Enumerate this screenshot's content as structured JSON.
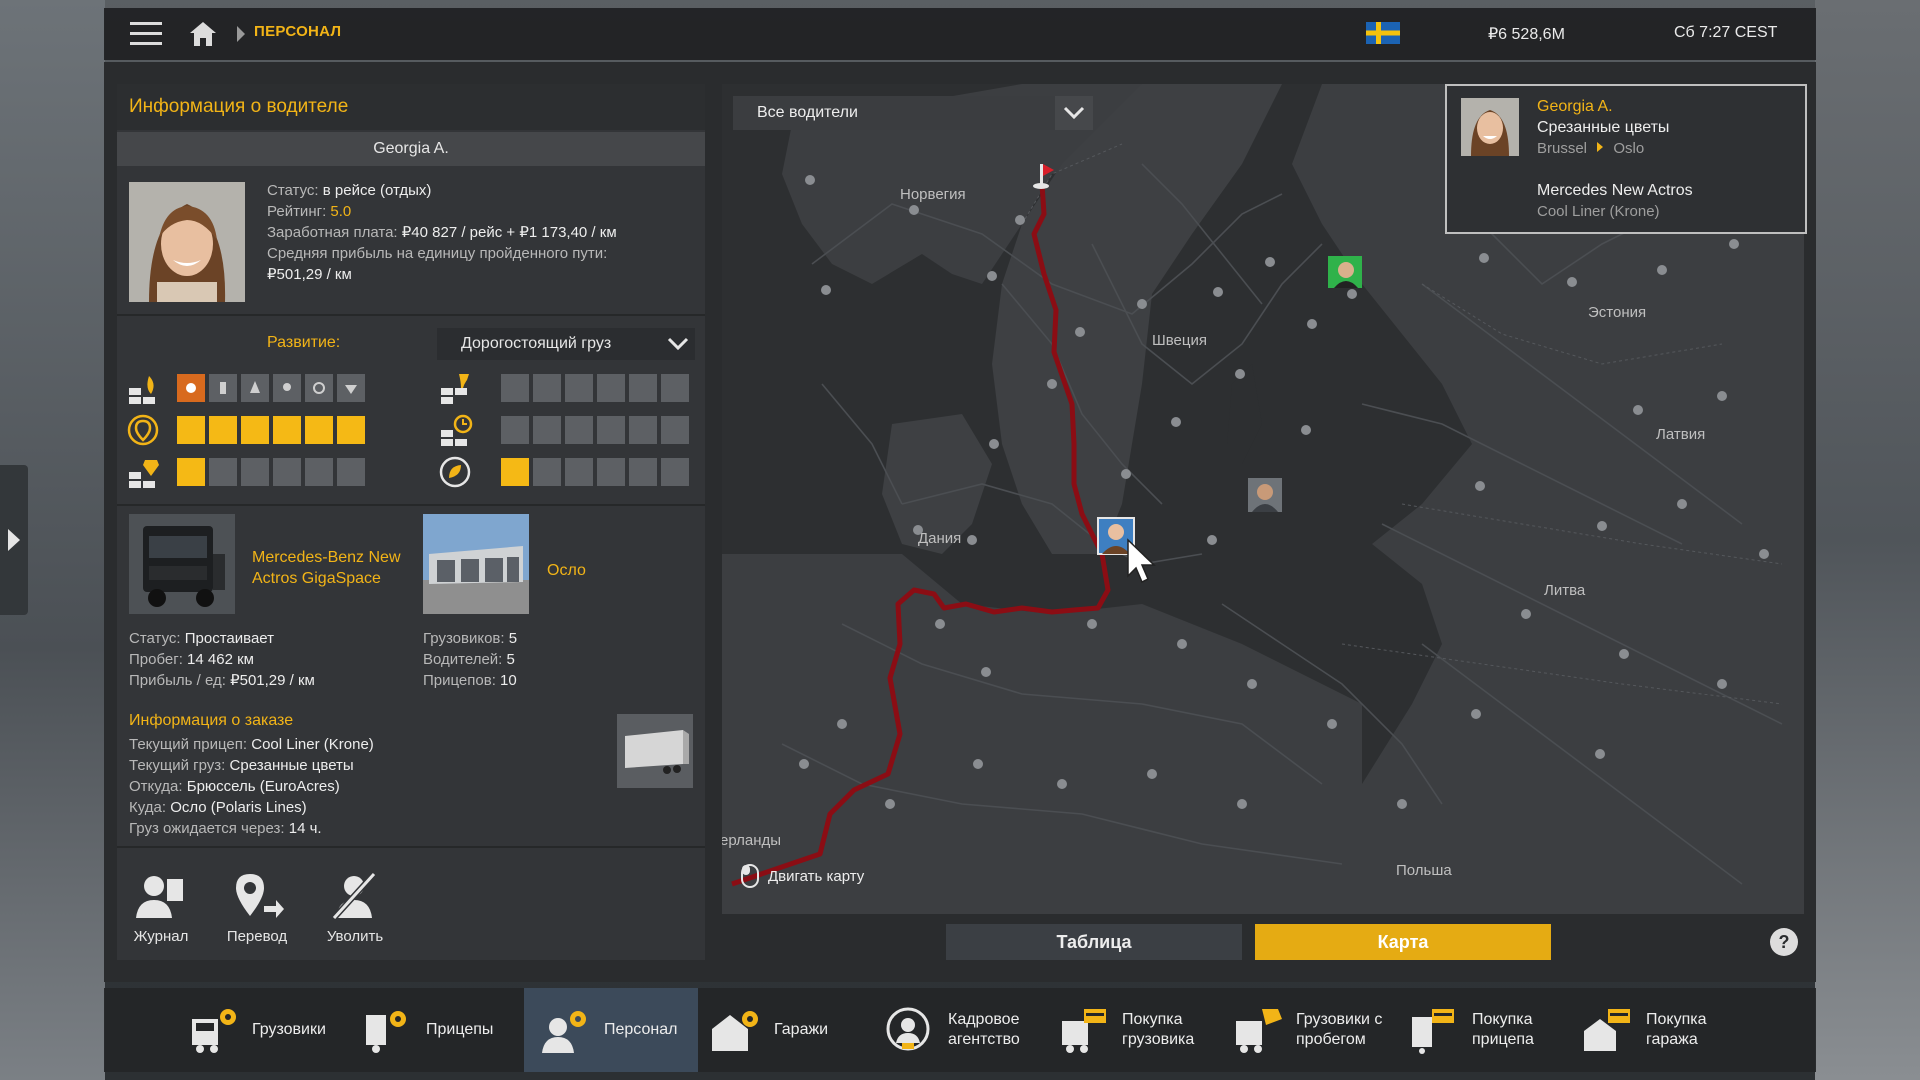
{
  "topbar": {
    "breadcrumb": "ПЕРСОНАЛ",
    "money": "₽6 528,6M",
    "clock": "Сб 7:27 CEST"
  },
  "driver_panel": {
    "header": "Информация о водителе",
    "name": "Georgia A.",
    "status_label": "Статус:",
    "status_value": "в рейсе (отдых)",
    "rating_label": "Рейтинг:",
    "rating_value": "5.0",
    "salary_label": "Заработная плата:",
    "salary_value": "₽40 827 / рейс + ₽1 173,40 / км",
    "profit_label": "Средняя прибыль на единицу пройденного пути:",
    "profit_value": "₽501,29 / км",
    "development_label": "Развитие:",
    "development_select": "Дорогостоящий груз",
    "skills": {
      "adr_on": 1,
      "distance": 6,
      "high_value": 1,
      "long_distance": 0,
      "fragile": 0,
      "eco": 1
    },
    "truck": {
      "name_line1": "Mercedes-Benz New",
      "name_line2": "Actros GigaSpace",
      "status_label": "Статус:",
      "status_value": "Простаивает",
      "mileage_label": "Пробег:",
      "mileage_value": "14 462 км",
      "profit_label": "Прибыль / ед:",
      "profit_value": "₽501,29 / км"
    },
    "garage": {
      "city": "Осло",
      "trucks_label": "Грузовиков:",
      "trucks_value": "5",
      "drivers_label": "Водителей:",
      "drivers_value": "5",
      "trailers_label": "Прицепов:",
      "trailers_value": "10"
    },
    "order": {
      "title": "Информация о заказе",
      "trailer_label": "Текущий прицеп:",
      "trailer_value": "Cool Liner (Krone)",
      "cargo_label": "Текущий груз:",
      "cargo_value": "Срезанные цветы",
      "from_label": "Откуда:",
      "from_value": "Брюссель (EuroAcres)",
      "to_label": "Куда:",
      "to_value": "Осло (Polaris Lines)",
      "eta_label": "Груз ожидается через:",
      "eta_value": "14 ч."
    },
    "actions": {
      "journal": "Журнал",
      "transfer": "Перевод",
      "fire": "Уволить"
    }
  },
  "map": {
    "driver_filter": "Все водители",
    "labels": {
      "norway": "Норвегия",
      "sweden": "Швеция",
      "denmark": "Дания",
      "estonia": "Эстония",
      "latvia": "Латвия",
      "lithuania": "Литва",
      "poland": "Польша",
      "netherlands": "ерланды"
    },
    "hint": "Двигать карту",
    "popup": {
      "name": "Georgia A.",
      "cargo": "Срезанные цветы",
      "route_from": "Brussel",
      "route_to": "Oslo",
      "truck": "Mercedes New Actros",
      "trailer": "Cool Liner (Krone)"
    },
    "view_table": "Таблица",
    "view_map": "Карта",
    "help": "?"
  },
  "bottom_nav": {
    "trucks": "Грузовики",
    "trailers": "Прицепы",
    "staff": "Персонал",
    "garages": "Гаражи",
    "agency_1": "Кадровое",
    "agency_2": "агентство",
    "buy_truck_1": "Покупка",
    "buy_truck_2": "грузовика",
    "used_trucks_1": "Грузовики с",
    "used_trucks_2": "пробегом",
    "buy_trailer_1": "Покупка",
    "buy_trailer_2": "прицепа",
    "buy_garage_1": "Покупка",
    "buy_garage_2": "гаража"
  },
  "colors": {
    "accent": "#f2b417",
    "route": "#8b0d14",
    "active_nav": "#3c4a5a"
  }
}
